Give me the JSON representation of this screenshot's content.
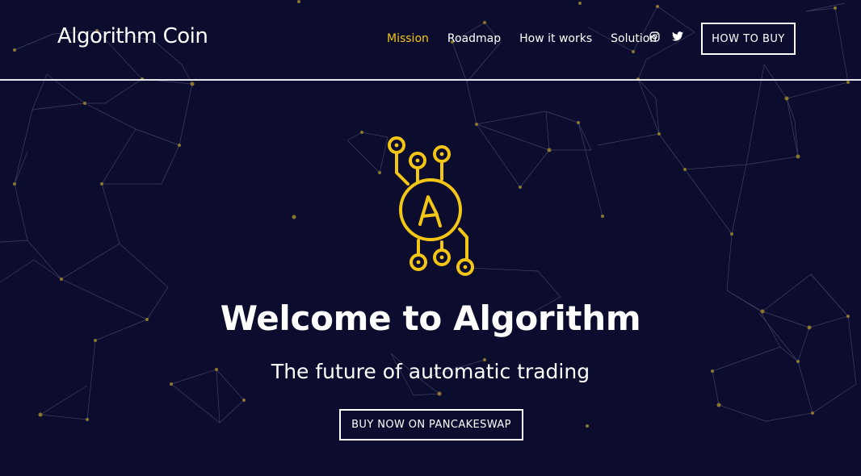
{
  "brand": {
    "name": "Algorithm Coin"
  },
  "nav": {
    "items": [
      {
        "label": "Mission",
        "active": true
      },
      {
        "label": "Roadmap",
        "active": false
      },
      {
        "label": "How it works",
        "active": false
      },
      {
        "label": "Solution",
        "active": false
      }
    ],
    "social": [
      "instagram-icon",
      "twitter-icon"
    ],
    "buy_label": "HOW TO BUY"
  },
  "hero": {
    "title": "Welcome to Algorithm",
    "subtitle": "The future of automatic trading",
    "cta_label": "BUY NOW ON PANCAKESWAP"
  },
  "colors": {
    "background": "#0c0d2e",
    "accent": "#f3c616",
    "network_lines": "#5a5d7a",
    "network_nodes": "#a08a2e"
  }
}
